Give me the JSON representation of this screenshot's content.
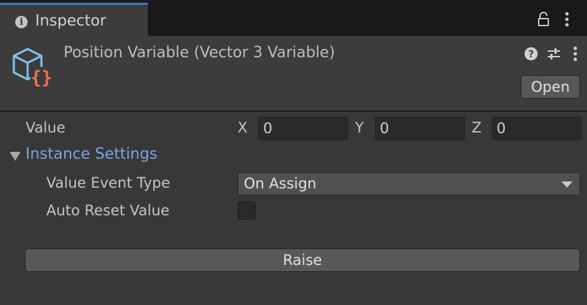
{
  "tab": {
    "title": "Inspector",
    "icon": "info-icon"
  },
  "tab_icons": {
    "lock": "lock-icon",
    "menu": "kebab-menu-icon"
  },
  "header": {
    "icon": "scriptable-object-icon",
    "title": "Position Variable (Vector 3 Variable)",
    "help_icon": "help-icon",
    "settings_icon": "presets-icon",
    "menu_icon": "kebab-menu-icon",
    "open_label": "Open"
  },
  "fields": {
    "value_label": "Value",
    "x_label": "X",
    "x_value": "0",
    "y_label": "Y",
    "y_value": "0",
    "z_label": "Z",
    "z_value": "0"
  },
  "instance_settings": {
    "label": "Instance Settings",
    "expanded": true,
    "event_type_label": "Value Event Type",
    "event_type_value": "On Assign",
    "auto_reset_label": "Auto Reset Value",
    "auto_reset_checked": false
  },
  "raise_label": "Raise",
  "colors": {
    "accent": "#3a79bb",
    "foldout_label": "#7ba4e0",
    "icon_cube": "#7fc4ea",
    "icon_braces": "#f0734a"
  }
}
